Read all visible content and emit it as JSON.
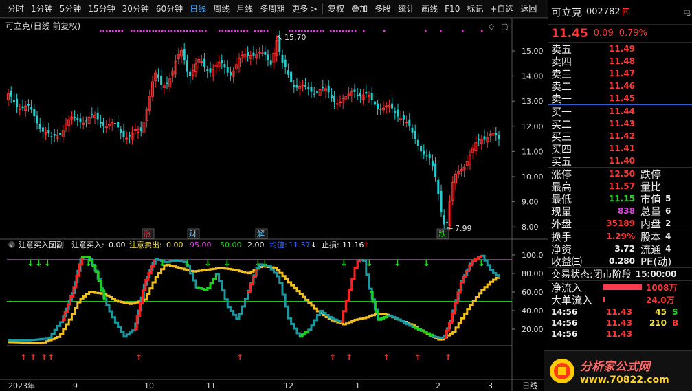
{
  "toolbar": {
    "items": [
      "分时",
      "1分钟",
      "5分钟",
      "15分钟",
      "30分钟",
      "60分钟",
      "日线",
      "周线",
      "月线",
      "多周期",
      "更多 >",
      "复权",
      "叠加",
      "多股",
      "统计",
      "画线",
      "F10",
      "标记",
      "+自选",
      "返回"
    ],
    "active": "日线"
  },
  "main_chart": {
    "title": "可立克(日线 前复权)",
    "high_label": "15.70",
    "low_label": "7.99",
    "y_ticks": [
      "15.00",
      "14.00",
      "13.00",
      "12.00",
      "11.00",
      "10.00",
      "9.00",
      "8.00"
    ],
    "markers": [
      "涨",
      "财",
      "解",
      "跌"
    ]
  },
  "indicator": {
    "title": "注意买入图副",
    "fields": [
      {
        "label": "注意买入:",
        "value": "0.00"
      },
      {
        "label": "注意卖出:",
        "value": "0.00"
      },
      {
        "label": "",
        "value": "95.00"
      },
      {
        "label": "",
        "value": "50.00"
      },
      {
        "label": "",
        "value": "2.00"
      },
      {
        "label": "均值:",
        "value": "11.37"
      },
      {
        "label": "止损:",
        "value": "11.16"
      }
    ],
    "y_ticks": [
      "100.0",
      "80.00",
      "60.00",
      "40.00",
      "20.00"
    ]
  },
  "x_axis": {
    "labels": [
      "2023年",
      "9",
      "10",
      "11",
      "12",
      "1",
      "2",
      "3"
    ],
    "period": "日线"
  },
  "chart_data": {
    "type": "candlestick+indicator",
    "price_range": [
      7.99,
      15.7
    ],
    "price_labels": {
      "high": 15.7,
      "low": 7.99
    },
    "indicator_range": [
      0,
      100
    ],
    "indicator_levels": [
      95.0,
      50.0,
      2.0
    ],
    "indicator_values": {
      "注意买入": 0.0,
      "注意卖出": 0.0,
      "均值": 11.37,
      "止损": 11.16
    }
  },
  "quote": {
    "name": "可立克",
    "code": "002782",
    "r_badge": "R",
    "side_tab": "电",
    "price": "11.45",
    "change": "0.09",
    "change_pct": "0.79%",
    "asks": [
      {
        "label": "卖五",
        "price": "11.49"
      },
      {
        "label": "卖四",
        "price": "11.48"
      },
      {
        "label": "卖三",
        "price": "11.47"
      },
      {
        "label": "卖二",
        "price": "11.46"
      },
      {
        "label": "卖一",
        "price": "11.45"
      }
    ],
    "bids": [
      {
        "label": "买一",
        "price": "11.44"
      },
      {
        "label": "买二",
        "price": "11.43"
      },
      {
        "label": "买三",
        "price": "11.42"
      },
      {
        "label": "买四",
        "price": "11.41"
      },
      {
        "label": "买五",
        "price": "11.40"
      }
    ],
    "stats": [
      {
        "l1": "涨停",
        "v1": "12.50",
        "l2": "跌停",
        "v2": ""
      },
      {
        "l1": "最高",
        "v1": "11.57",
        "l2": "量比",
        "v2": ""
      },
      {
        "l1": "最低",
        "v1": "11.15",
        "l2": "市值",
        "v2": "5"
      },
      {
        "l1": "现量",
        "v1": "838",
        "l2": "总量",
        "v2": "6"
      },
      {
        "l1": "外盘",
        "v1": "35189",
        "l2": "内盘",
        "v2": "2"
      }
    ],
    "stats2": [
      {
        "l1": "换手",
        "v1": "1.29%",
        "l2": "股本",
        "v2": "4"
      },
      {
        "l1": "净资",
        "v1": "3.72",
        "l2": "流通",
        "v2": "4"
      },
      {
        "l1": "收益㈢",
        "v1": "0.280",
        "l2": "PE(动)",
        "v2": ""
      }
    ],
    "trade_status_label": "交易状态:",
    "trade_status": "闭市阶段",
    "trade_time": "15:00:00",
    "net_inflow_label": "净流入",
    "net_inflow": "1008万",
    "big_inflow_label": "大单流入",
    "big_inflow": "24.0万",
    "ticks": [
      {
        "time": "14:56",
        "price": "11.43",
        "vol": "45",
        "dir": "S"
      },
      {
        "time": "14:56",
        "price": "11.43",
        "vol": "210",
        "dir": "B"
      },
      {
        "time": "14:56",
        "price": "11.43",
        "vol": "",
        "dir": ""
      }
    ]
  },
  "logo": {
    "title": "分析家公式网",
    "url": "www.70822.com"
  },
  "colors": {
    "up": "#ff3030",
    "down": "#20d0d0",
    "accent": "#3ea8ff"
  }
}
